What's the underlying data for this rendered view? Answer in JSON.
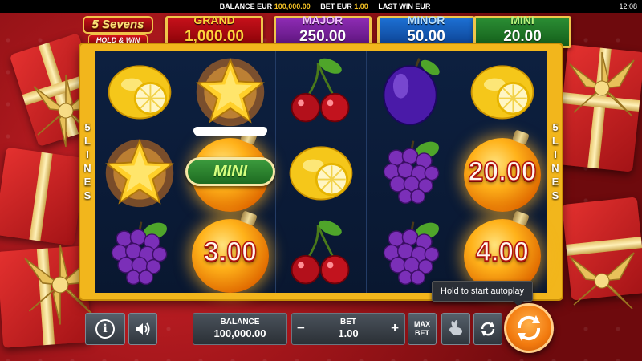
{
  "status_bar": {
    "balance_label": "BALANCE EUR",
    "balance_value": "100,000.00",
    "bet_label": "BET EUR",
    "bet_value": "1.00",
    "last_win_label": "LAST WIN EUR",
    "last_win_value": "",
    "time": "12:08"
  },
  "logo": {
    "title": "5 Sevens",
    "subtitle": "HOLD & WIN"
  },
  "jackpots": {
    "grand": {
      "label": "GRAND",
      "value": "1,000.00",
      "color": "#c4101a"
    },
    "major": {
      "label": "MAJOR",
      "value": "250.00",
      "color": "#8d2bb3"
    },
    "minor": {
      "label": "MINOR",
      "value": "50.00",
      "color": "#1c6fd2"
    },
    "mini": {
      "label": "MINI",
      "value": "20.00",
      "color": "#2a8c33"
    }
  },
  "lines": {
    "left": [
      "5",
      "L",
      "I",
      "N",
      "E",
      "S"
    ],
    "right": [
      "5",
      "L",
      "I",
      "N",
      "E",
      "S"
    ]
  },
  "reels": [
    [
      {
        "symbol": "lemon"
      },
      {
        "symbol": "star"
      },
      {
        "symbol": "grapes"
      }
    ],
    [
      {
        "symbol": "star"
      },
      {
        "symbol": "orb",
        "badge": "MINI"
      },
      {
        "symbol": "orb",
        "value": "3.00"
      }
    ],
    [
      {
        "symbol": "cherry"
      },
      {
        "symbol": "lemon"
      },
      {
        "symbol": "cherry"
      }
    ],
    [
      {
        "symbol": "plum"
      },
      {
        "symbol": "grapes"
      },
      {
        "symbol": "grapes"
      }
    ],
    [
      {
        "symbol": "lemon"
      },
      {
        "symbol": "orb",
        "value": "20.00"
      },
      {
        "symbol": "orb",
        "value": "4.00"
      }
    ]
  ],
  "controls": {
    "info_icon": "info-icon",
    "sound_icon": "speaker-icon",
    "balance_label": "BALANCE",
    "balance_value": "100,000.00",
    "bet_label": "BET",
    "bet_value": "1.00",
    "bet_minus": "−",
    "bet_plus": "+",
    "max_bet_line1": "MAX",
    "max_bet_line2": "BET",
    "turbo_icon": "rabbit-icon",
    "autoplay_icon": "autoplay-icon",
    "spin_icon": "spin-icon"
  },
  "tooltip": "Hold to start autoplay",
  "accent_colors": {
    "frame": "#f2b61c",
    "spin": "#f27a0e",
    "background": "#8e0d10"
  }
}
